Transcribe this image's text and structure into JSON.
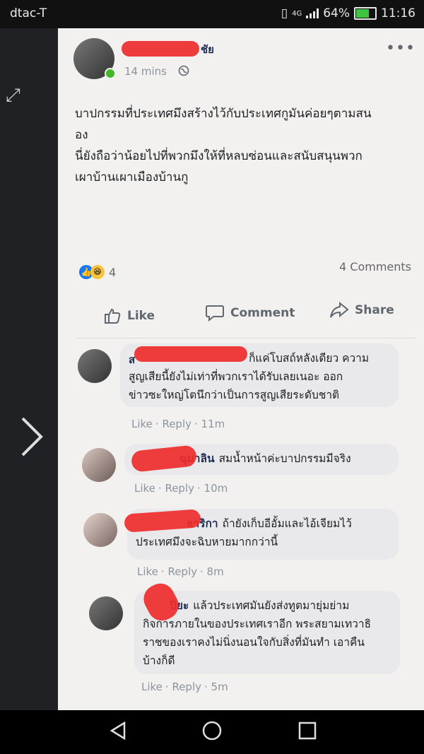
{
  "status_bar": {
    "carrier": "dtac-T",
    "network": "4G",
    "battery": "64%",
    "time": "11:16"
  },
  "post": {
    "author_name_visible": "ชัย",
    "time": "14 mins",
    "text_lines": [
      "บาปกรรมที่ประเทศมึงสร้างไว้กับประเทศกูมันค่อยๆตามสน",
      "อง",
      "นี่ยังถือว่าน้อยไปที่พวกมึงให้ที่หลบซ่อนและสนับสนุนพวก",
      "เผาบ้านเผาเมืองบ้านกู"
    ],
    "reaction_count": "4",
    "comment_count": "4 Comments"
  },
  "actions": {
    "like": "Like",
    "comment": "Comment",
    "share": "Share"
  },
  "comments": [
    {
      "name_visible": "ส",
      "lines": [
        "ก็แค่โบสถ์หลังเดียว ความ",
        "สูญเสียนี้ยังไม่เท่าที่พวกเราได้รับเลยเนอะ ออก",
        "ข่าวซะใหญ่โตนึกว่าเป็นการสูญเสียระดับชาติ"
      ],
      "like": "Like",
      "reply": "Reply",
      "time": "11m"
    },
    {
      "name_visible": "ฉุมาลิน",
      "lines": [
        "สมน้ำหน้าค่ะบาปกรรมมีจริง"
      ],
      "like": "Like",
      "reply": "Reply",
      "time": "10m"
    },
    {
      "name_visible": "ธาริกา",
      "lines": [
        "ถ้ายังเก็บอีอั้มและไอ้เจียมไว้",
        "ประเทศมึงจะฉิบหายมากกว่านี้"
      ],
      "like": "Like",
      "reply": "Reply",
      "time": "8m"
    },
    {
      "name_visible": "ปิยะ",
      "lines": [
        "แล้วประเทศมันยังส่งทูตมายุ่มย่าม",
        "กิจการภายในของประเทศเราอีก พระสยามเทวาธิ",
        "ราชของเราคงไม่นิ่งนอนใจกับสิ่งที่มันทำ เอาคืน",
        "บ้างก็ดี"
      ],
      "like": "Like",
      "reply": "Reply",
      "time": "5m"
    }
  ],
  "colors": {
    "like_blue": "#1877f2",
    "redaction_red": "#ee2b2b",
    "online_green": "#42b72a"
  }
}
